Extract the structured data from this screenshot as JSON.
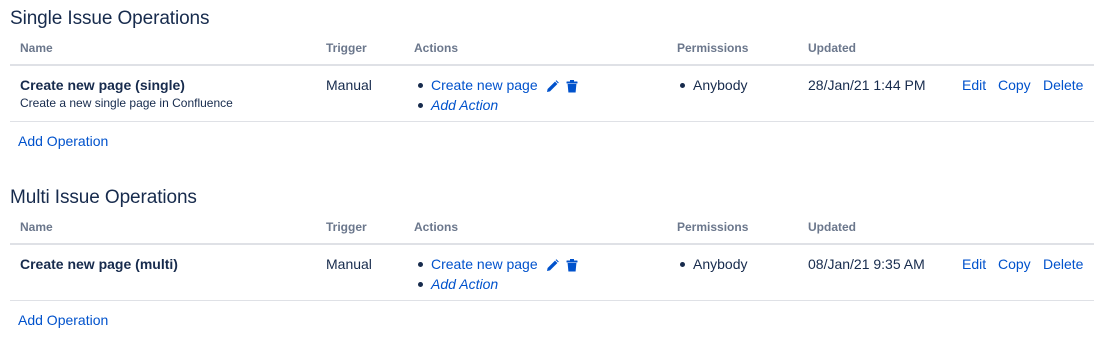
{
  "columns": {
    "name": "Name",
    "trigger": "Trigger",
    "actions": "Actions",
    "permissions": "Permissions",
    "updated": "Updated"
  },
  "sections": [
    {
      "title": "Single Issue Operations",
      "row": {
        "name": "Create new page (single)",
        "description": "Create a new single page in Confluence",
        "trigger": "Manual",
        "action_link": "Create new page",
        "add_action": "Add Action",
        "permission": "Anybody",
        "updated": "28/Jan/21 1:44 PM",
        "edit": "Edit",
        "copy": "Copy",
        "delete": "Delete"
      },
      "add_operation": "Add Operation"
    },
    {
      "title": "Multi Issue Operations",
      "row": {
        "name": "Create new page (multi)",
        "description": "",
        "trigger": "Manual",
        "action_link": "Create new page",
        "add_action": "Add Action",
        "permission": "Anybody",
        "updated": "08/Jan/21 9:35 AM",
        "edit": "Edit",
        "copy": "Copy",
        "delete": "Delete"
      },
      "add_operation": "Add Operation"
    }
  ],
  "icons": {
    "edit": "pencil-icon",
    "delete": "trash-icon"
  },
  "colors": {
    "link": "#0052cc",
    "text": "#172b4d",
    "header_text": "#6b778c",
    "divider": "#dfe1e6"
  }
}
